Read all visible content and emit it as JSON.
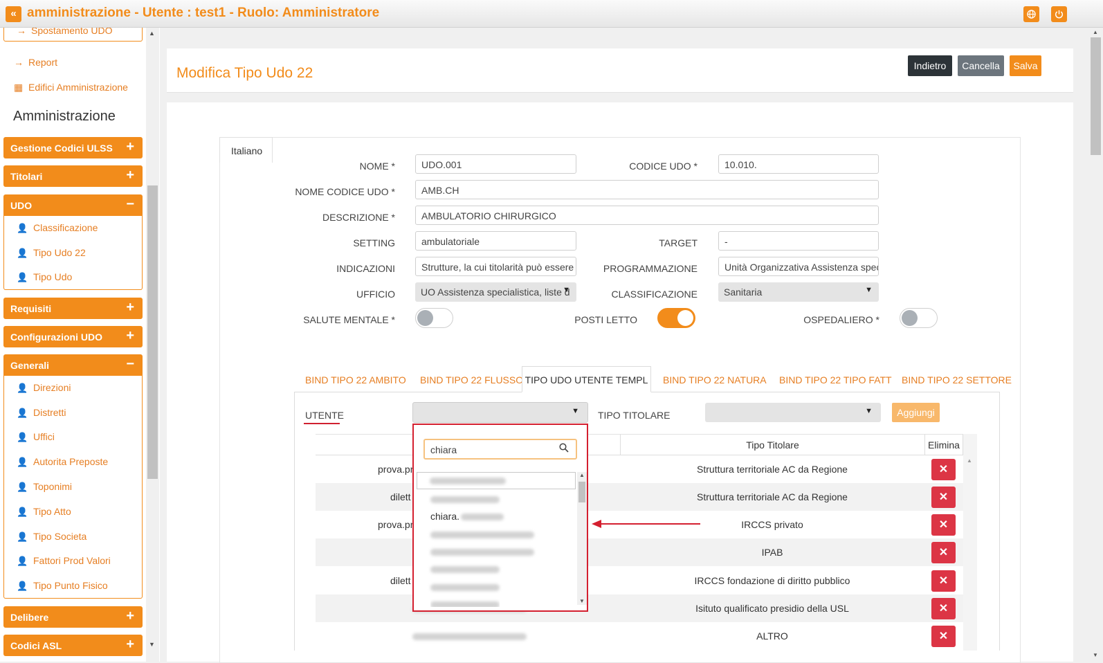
{
  "header": {
    "collapse_icon": "«",
    "title": "amministrazione - Utente : test1 - Ruolo: Amministratore",
    "globe_icon": "globe-icon",
    "power_icon": "power-icon"
  },
  "sidebar": {
    "top_item": "Spostamento UDO",
    "links": [
      {
        "label": "Report",
        "icon": "→"
      },
      {
        "label": "Edifici Amministrazione",
        "icon": "▦"
      }
    ],
    "heading": "Amministrazione",
    "sections": [
      {
        "label": "Gestione Codici ULSS",
        "toggle": "+"
      },
      {
        "label": "Titolari",
        "toggle": "+"
      },
      {
        "label": "UDO",
        "toggle": "−",
        "items": [
          "Classificazione",
          "Tipo Udo 22",
          "Tipo Udo"
        ]
      },
      {
        "label": "Requisiti",
        "toggle": "+"
      },
      {
        "label": "Configurazioni UDO",
        "toggle": "+"
      },
      {
        "label": "Generali",
        "toggle": "−",
        "items": [
          "Direzioni",
          "Distretti",
          "Uffici",
          "Autorita Preposte",
          "Toponimi",
          "Tipo Atto",
          "Tipo Societa",
          "Fattori Prod Valori",
          "Tipo Punto Fisico"
        ]
      },
      {
        "label": "Delibere",
        "toggle": "+"
      },
      {
        "label": "Codici ASL",
        "toggle": "+"
      }
    ]
  },
  "page": {
    "title": "Modifica Tipo Udo 22",
    "buttons": {
      "back": "Indietro",
      "delete": "Cancella",
      "save": "Salva"
    },
    "lang_tab": "Italiano"
  },
  "form": {
    "nome": {
      "label": "NOME *",
      "value": "UDO.001"
    },
    "codice_udo": {
      "label": "CODICE UDO *",
      "value": "10.010."
    },
    "nome_codice_udo": {
      "label": "NOME CODICE UDO *",
      "value": "AMB.CH"
    },
    "descrizione": {
      "label": "DESCRIZIONE *",
      "value": "AMBULATORIO CHIRURGICO"
    },
    "setting": {
      "label": "SETTING",
      "value": "ambulatoriale"
    },
    "target": {
      "label": "TARGET",
      "value": "-"
    },
    "indicazioni": {
      "label": "INDICAZIONI",
      "value": "Strutture, la cui titolarità può essere r"
    },
    "programmazione": {
      "label": "PROGRAMMAZIONE",
      "value": "Unità Organizzativa Assistenza speci"
    },
    "ufficio": {
      "label": "UFFICIO",
      "value": "UO Assistenza specialistica, liste d"
    },
    "classificazione": {
      "label": "CLASSIFICAZIONE",
      "value": "Sanitaria"
    },
    "salute_mentale": {
      "label": "SALUTE MENTALE *",
      "on": false
    },
    "posti_letto": {
      "label": "POSTI LETTO",
      "on": true
    },
    "ospedaliero": {
      "label": "OSPEDALIERO *",
      "on": false
    }
  },
  "subtabs": [
    "BIND TIPO 22 AMBITO",
    "BIND TIPO 22 FLUSSO",
    "TIPO UDO UTENTE TEMPL",
    "BIND TIPO 22 NATURA",
    "BIND TIPO 22 TIPO FATT",
    "BIND TIPO 22 SETTORE"
  ],
  "assign": {
    "utente_label": "UTENTE",
    "tipo_titolare_label": "TIPO TITOLARE",
    "add_button": "Aggiungi"
  },
  "table": {
    "columns": [
      "Tipo Titolare",
      "Elimina"
    ],
    "rows": [
      {
        "utente": "prova.pr",
        "tipo": "Struttura territoriale AC da Regione"
      },
      {
        "utente": "dilett",
        "tipo": "Struttura territoriale AC da Regione"
      },
      {
        "utente": "prova.pr",
        "tipo": "IRCCS privato"
      },
      {
        "utente": "",
        "tipo": "IPAB"
      },
      {
        "utente": "dilett",
        "tipo": "IRCCS fondazione di diritto pubblico"
      },
      {
        "utente": "",
        "tipo": "Isituto qualificato presidio della USL"
      },
      {
        "utente": "",
        "tipo": "ALTRO"
      }
    ],
    "delete_icon": "✕"
  },
  "dropdown": {
    "search_value": "chiara",
    "search_icon": "search-icon",
    "visible_option": "chiara."
  },
  "colors": {
    "accent": "#f28c1b",
    "danger": "#dc3545",
    "highlight": "#d41f2f"
  }
}
